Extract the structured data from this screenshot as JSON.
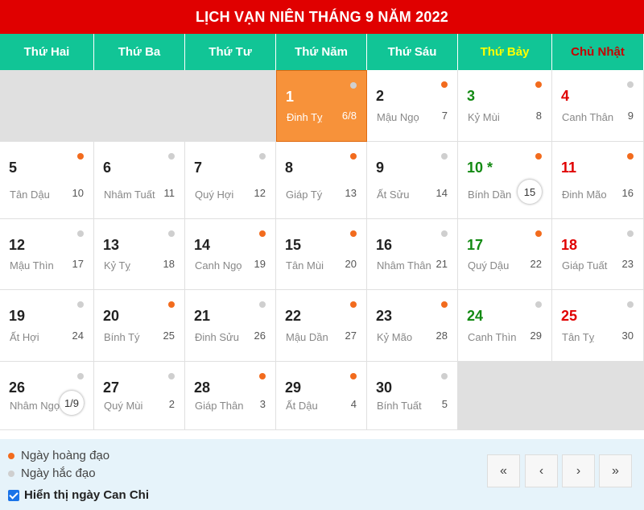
{
  "title": "LỊCH VẠN NIÊN THÁNG 9 NĂM 2022",
  "weekdays": [
    "Thứ Hai",
    "Thứ Ba",
    "Thứ Tư",
    "Thứ Năm",
    "Thứ Sáu",
    "Thứ Bảy",
    "Chủ Nhật"
  ],
  "days": [
    {
      "solar": "1",
      "canchi": "Đinh Tỵ",
      "lunar": "6/8",
      "type": "bad",
      "today": true
    },
    {
      "solar": "2",
      "canchi": "Mậu Ngọ",
      "lunar": "7",
      "type": "good"
    },
    {
      "solar": "3",
      "canchi": "Kỷ Mùi",
      "lunar": "8",
      "type": "good"
    },
    {
      "solar": "4",
      "canchi": "Canh Thân",
      "lunar": "9",
      "type": "bad"
    },
    {
      "solar": "5",
      "canchi": "Tân Dậu",
      "lunar": "10",
      "type": "good"
    },
    {
      "solar": "6",
      "canchi": "Nhâm Tuất",
      "lunar": "11",
      "type": "bad"
    },
    {
      "solar": "7",
      "canchi": "Quý Hợi",
      "lunar": "12",
      "type": "bad"
    },
    {
      "solar": "8",
      "canchi": "Giáp Tý",
      "lunar": "13",
      "type": "good"
    },
    {
      "solar": "9",
      "canchi": "Ất Sửu",
      "lunar": "14",
      "type": "bad"
    },
    {
      "solar": "10 *",
      "canchi": "Bính Dần",
      "lunar": "15",
      "type": "good",
      "circled": true
    },
    {
      "solar": "11",
      "canchi": "Đinh Mão",
      "lunar": "16",
      "type": "good"
    },
    {
      "solar": "12",
      "canchi": "Mậu Thìn",
      "lunar": "17",
      "type": "bad"
    },
    {
      "solar": "13",
      "canchi": "Kỷ Tỵ",
      "lunar": "18",
      "type": "bad"
    },
    {
      "solar": "14",
      "canchi": "Canh Ngọ",
      "lunar": "19",
      "type": "good"
    },
    {
      "solar": "15",
      "canchi": "Tân Mùi",
      "lunar": "20",
      "type": "good"
    },
    {
      "solar": "16",
      "canchi": "Nhâm Thân",
      "lunar": "21",
      "type": "bad"
    },
    {
      "solar": "17",
      "canchi": "Quý Dậu",
      "lunar": "22",
      "type": "good"
    },
    {
      "solar": "18",
      "canchi": "Giáp Tuất",
      "lunar": "23",
      "type": "bad"
    },
    {
      "solar": "19",
      "canchi": "Ất Hợi",
      "lunar": "24",
      "type": "bad"
    },
    {
      "solar": "20",
      "canchi": "Bính Tý",
      "lunar": "25",
      "type": "good"
    },
    {
      "solar": "21",
      "canchi": "Đinh Sửu",
      "lunar": "26",
      "type": "bad"
    },
    {
      "solar": "22",
      "canchi": "Mậu Dần",
      "lunar": "27",
      "type": "good"
    },
    {
      "solar": "23",
      "canchi": "Kỷ Mão",
      "lunar": "28",
      "type": "good"
    },
    {
      "solar": "24",
      "canchi": "Canh Thìn",
      "lunar": "29",
      "type": "bad"
    },
    {
      "solar": "25",
      "canchi": "Tân Tỵ",
      "lunar": "30",
      "type": "bad"
    },
    {
      "solar": "26",
      "canchi": "Nhâm Ngọ",
      "lunar": "1/9",
      "type": "bad",
      "circled": true
    },
    {
      "solar": "27",
      "canchi": "Quý Mùi",
      "lunar": "2",
      "type": "bad"
    },
    {
      "solar": "28",
      "canchi": "Giáp Thân",
      "lunar": "3",
      "type": "good"
    },
    {
      "solar": "29",
      "canchi": "Ất Dậu",
      "lunar": "4",
      "type": "good"
    },
    {
      "solar": "30",
      "canchi": "Bính Tuất",
      "lunar": "5",
      "type": "bad"
    }
  ],
  "legend": {
    "good": "Ngày hoàng đạo",
    "bad": "Ngày hắc đạo"
  },
  "checkbox_label": "Hiển thị ngày Can Chi",
  "nav": {
    "first": "«",
    "prev": "‹",
    "next": "›",
    "last": "»"
  },
  "colors": {
    "header_red": "#e00000",
    "weekday_green": "#11c596",
    "today_orange": "#f7923a",
    "good_dot": "#f26b1d",
    "bad_dot": "#cfcfcf"
  }
}
